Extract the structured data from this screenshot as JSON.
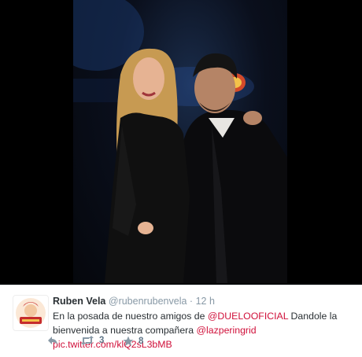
{
  "tweet": {
    "author_name": "Ruben Vela",
    "author_handle": "@rubenrubenvela",
    "separator": "·",
    "timestamp": "12 h",
    "text_part1": "En la posada de nuestro amigos de ",
    "mention1": "@DUELOOFICIAL",
    "text_part2": " Dandole la bienvenida a nuestra compañera ",
    "mention2": "@lazperingrid",
    "space": " ",
    "media_link": "pic.twitter.com/klQ2sL3bMB",
    "retweet_count": "3",
    "favorite_count": "8"
  },
  "icons": {
    "reply": "reply-icon",
    "retweet": "retweet-icon",
    "favorite": "star-icon",
    "avatar": "avatar"
  },
  "colors": {
    "link": "#d0103a",
    "name": "#292f33",
    "meta": "#8899a6",
    "action": "#5f7587"
  }
}
